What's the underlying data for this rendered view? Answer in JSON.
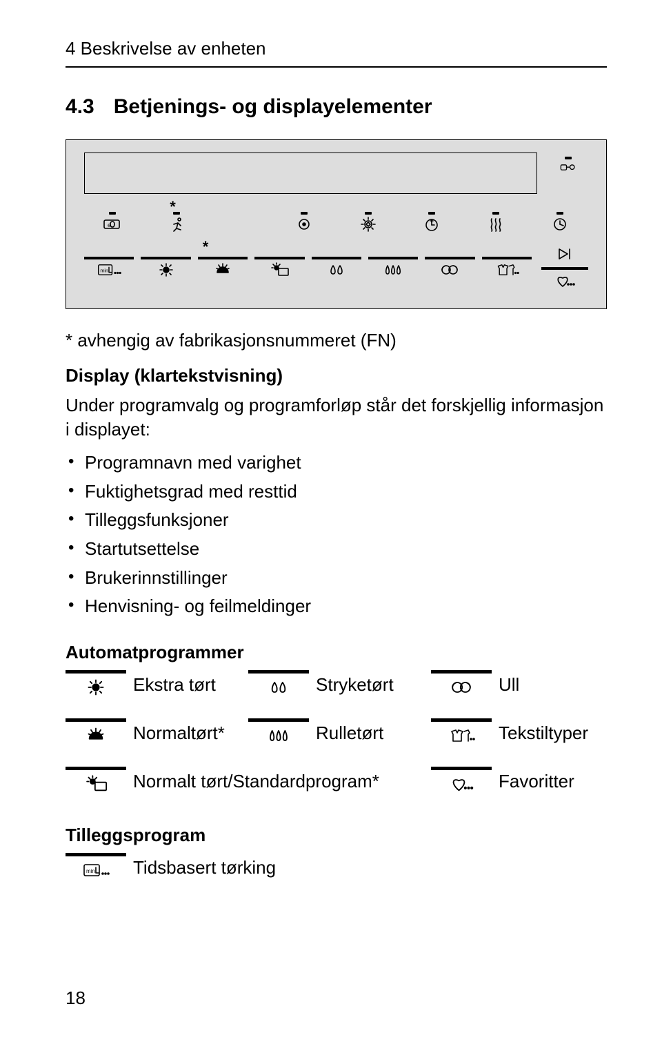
{
  "page": {
    "header": "4 Beskrivelse av enheten",
    "number": "18"
  },
  "section": {
    "number": "4.3",
    "title": "Betjenings- og displayelementer"
  },
  "panel": {
    "row1_icons": [
      "eco-icon",
      "runner-icon",
      "",
      "dry-target-icon",
      "burst-icon",
      "timer-plus-icon",
      "steam-icon",
      "clock-icon"
    ],
    "row2_icons": [
      "time-min-icon",
      "sun-high-icon",
      "sun-half-icon",
      "sun-box-icon",
      "drops2-icon",
      "drops3-icon",
      "wool-icon",
      "textile-icon"
    ],
    "right_icons": [
      "key-lock-icon",
      "play-skip-icon",
      "heart-icon"
    ]
  },
  "note": "* avhengig av fabrikasjonsnummeret (FN)",
  "display": {
    "heading": "Display (klartekstvisning)",
    "intro": "Under programvalg og programforløp står det forskjellig informasjon i displayet:",
    "bullets": [
      "Programnavn med varighet",
      "Fuktighetsgrad med resttid",
      "Tilleggsfunksjoner",
      "Startutsettelse",
      "Brukerinnstillinger",
      "Henvisning- og feilmeldinger"
    ]
  },
  "automat": {
    "heading": "Automatprogrammer",
    "rows": [
      {
        "icon": "sun-high-icon",
        "label": "Ekstra tørt",
        "icon2": "drops2-icon",
        "label2": "Stryketørt",
        "icon3": "wool-icon",
        "label3": "Ull"
      },
      {
        "icon": "sun-half-icon",
        "label": "Normaltørt*",
        "icon2": "drops3-icon",
        "label2": "Rulletørt",
        "icon3": "textile-icon",
        "label3": "Tekstiltyper"
      },
      {
        "icon": "sun-box-icon",
        "label": "Normalt tørt/Standardprogram*",
        "icon2": "",
        "label2": "",
        "icon3": "heart-icon",
        "label3": "Favoritter"
      }
    ]
  },
  "tillegg": {
    "heading": "Tilleggsprogram",
    "rows": [
      {
        "icon": "time-min-icon",
        "label": "Tidsbasert tørking"
      }
    ]
  }
}
